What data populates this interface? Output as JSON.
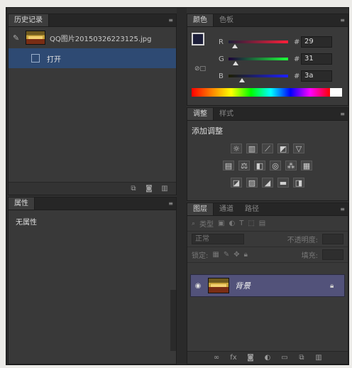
{
  "history": {
    "tab": "历史记录",
    "snapshot_name": "QQ图片20150326223125.jpg",
    "steps": [
      "打开"
    ]
  },
  "properties": {
    "tab": "属性",
    "empty_text": "无属性"
  },
  "color": {
    "tabs": [
      "颜色",
      "色板"
    ],
    "foreground": "#1d1f3a",
    "background": "#000000",
    "channels": [
      {
        "label": "R",
        "hash": "#",
        "value": "29",
        "position": 0.11
      },
      {
        "label": "G",
        "hash": "#",
        "value": "31",
        "position": 0.12
      },
      {
        "label": "B",
        "hash": "#",
        "value": "3a",
        "position": 0.23
      }
    ]
  },
  "adjustments": {
    "tabs": [
      "调整",
      "样式"
    ],
    "title": "添加调整"
  },
  "layers": {
    "tabs": [
      "图层",
      "通道",
      "路径"
    ],
    "filter_kind": "类型",
    "blend_mode": "正常",
    "opacity_label": "不透明度:",
    "lock_label": "锁定:",
    "fill_label": "填充:",
    "layer_name": "背景"
  }
}
